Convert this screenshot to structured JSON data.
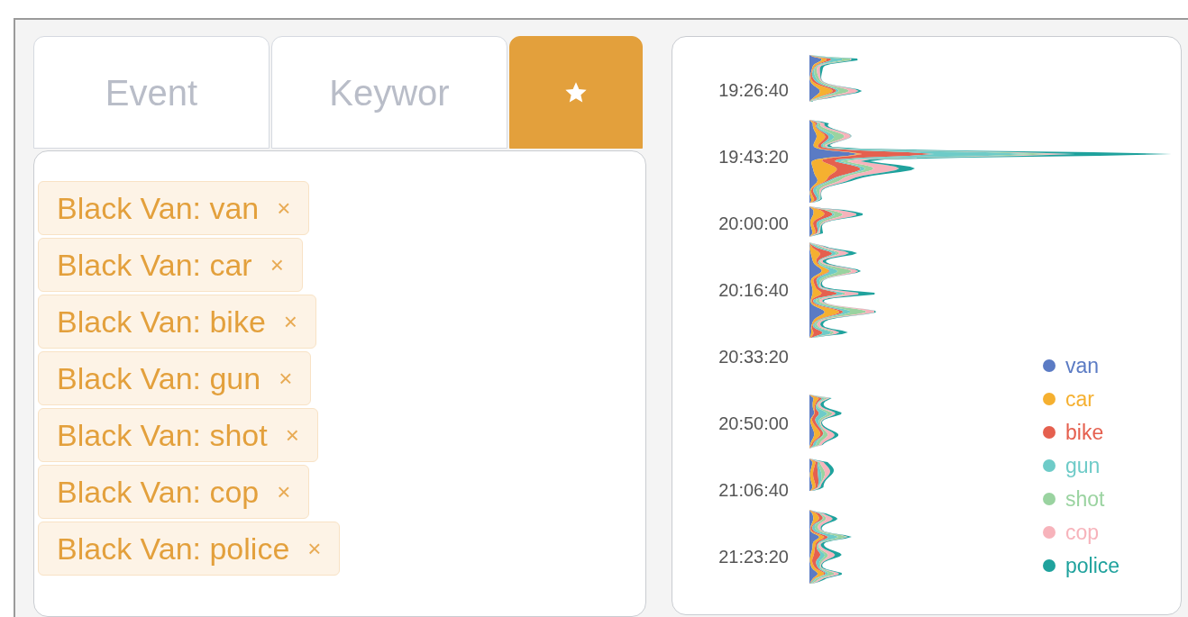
{
  "tabs": [
    {
      "kind": "text",
      "label": "Event",
      "selected": false
    },
    {
      "kind": "text",
      "label": "Keywor",
      "selected": false
    },
    {
      "kind": "star",
      "selected": true
    }
  ],
  "tags": [
    {
      "label": "Black Van: van",
      "remove": "×"
    },
    {
      "label": "Black Van: car",
      "remove": "×"
    },
    {
      "label": "Black Van: bike",
      "remove": "×"
    },
    {
      "label": "Black Van: gun",
      "remove": "×"
    },
    {
      "label": "Black Van: shot",
      "remove": "×"
    },
    {
      "label": "Black Van: cop",
      "remove": "×"
    },
    {
      "label": "Black Van: police",
      "remove": "×"
    }
  ],
  "timeline": {
    "time_labels": [
      "19:26:40",
      "19:43:20",
      "20:00:00",
      "20:16:40",
      "20:33:20",
      "20:50:00",
      "21:06:40",
      "21:23:20"
    ],
    "legend": [
      {
        "label": "van",
        "color": "#5b7bc4"
      },
      {
        "label": "car",
        "color": "#f5b030"
      },
      {
        "label": "bike",
        "color": "#e5604f"
      },
      {
        "label": "gun",
        "color": "#6ecbc8"
      },
      {
        "label": "shot",
        "color": "#9ad3a0"
      },
      {
        "label": "cop",
        "color": "#f7b3bb"
      },
      {
        "label": "police",
        "color": "#1fa29d"
      }
    ]
  }
}
